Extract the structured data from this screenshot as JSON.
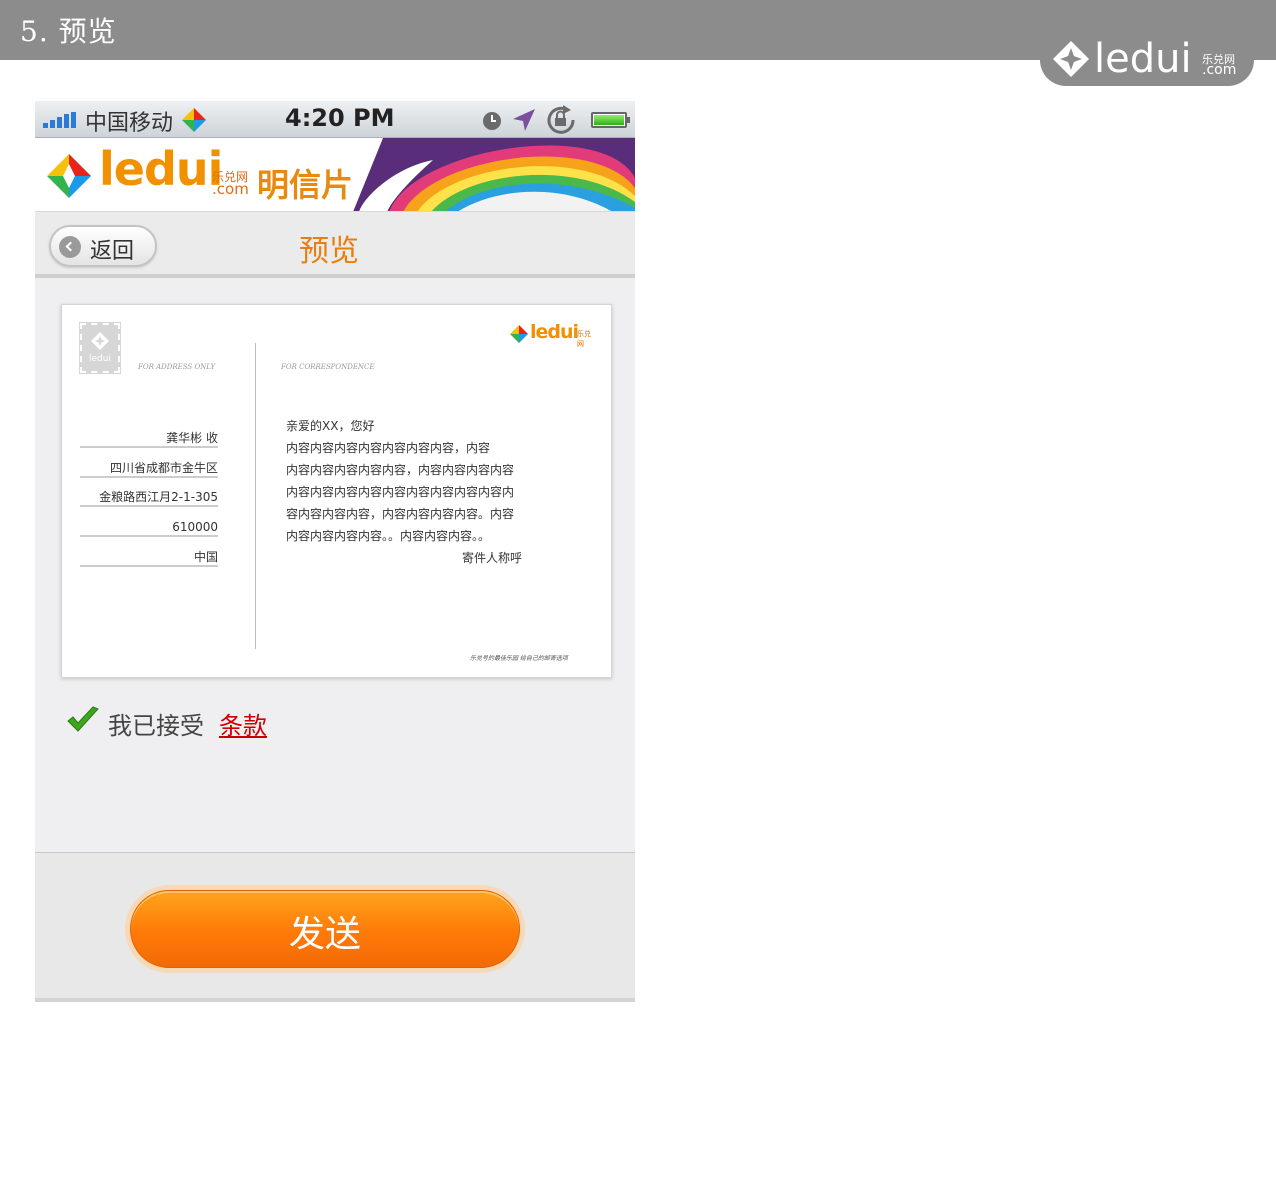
{
  "slide": {
    "title": "5. 预览",
    "brand": {
      "word": "ledui",
      "cn": "乐兑网",
      "com": ".com"
    }
  },
  "statusbar": {
    "carrier": "中国移动",
    "time": "4:20 PM",
    "icons": [
      "signal-bars-icon",
      "carrier-logo-icon",
      "clock-icon",
      "location-arrow-icon",
      "rotation-lock-icon",
      "battery-icon"
    ]
  },
  "banner": {
    "word": "ledui",
    "cn": "乐兑网",
    "com": ".com",
    "product": "明信片"
  },
  "navbar": {
    "back_label": "返回",
    "title": "预览"
  },
  "postcard": {
    "stamp_word": "ledui",
    "logo_word": "ledui",
    "logo_cn": "乐兑网",
    "address_caption": "FOR ADDRESS ONLY",
    "correspondence_caption": "FOR CORRESPONDENCE",
    "address_lines": [
      "龚华彬   收",
      "四川省成都市金牛区",
      "金粮路西江月2-1-305",
      "610000",
      "中国"
    ],
    "letter_lines": [
      "亲爱的XX，您好",
      "      内容内容内容内容内容内容内容，内容",
      "内容内容内容内容内容，内容内容内容内容",
      "内容内容内容内容内容内容内容内容内容内",
      "容内容内容内容，内容内容内容内容。内容",
      "内容内容内容内容。。内容内容内容。。"
    ],
    "signature": "寄件人称呼",
    "footer_note": "乐兑号的最佳乐园 给自己的邮寄选项"
  },
  "terms": {
    "accepted_label": "我已接受",
    "link_label": "条款",
    "checked": true
  },
  "send": {
    "label": "发送"
  },
  "colors": {
    "accent_orange": "#ff7a08",
    "title_orange": "#e87e10",
    "link_red": "#cc0000",
    "header_gray": "#8c8c8c"
  }
}
